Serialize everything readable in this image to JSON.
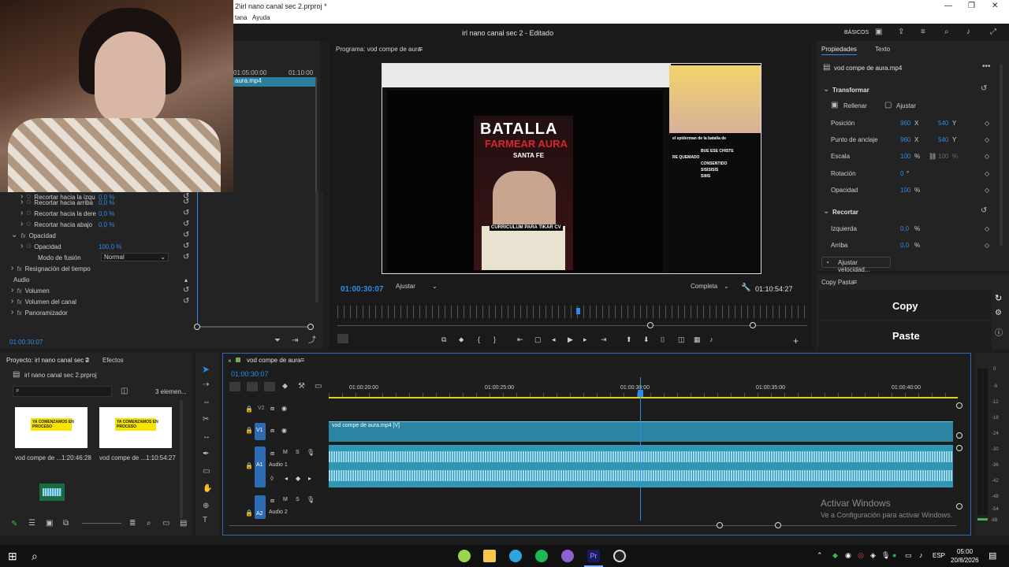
{
  "window": {
    "title": "2\\irl nano canal sec 2.prproj *",
    "controls": [
      "—",
      "❐",
      "✕"
    ]
  },
  "menu": [
    "tana",
    "Ayuda"
  ],
  "appbar": {
    "center_title": "irl nano canal sec 2 - Editado",
    "workspace": "BÁSICOS"
  },
  "source_panel": {
    "tc_left": "01:05:00:00",
    "tc_right": "01:10:00",
    "clip": "aura.mp4"
  },
  "effects": {
    "rows": [
      {
        "label": "Recortar hacia la izqu",
        "value": "0,0 %"
      },
      {
        "label": "Recortar hacia arriba",
        "value": "0,0 %"
      },
      {
        "label": "Recortar hacia la dere",
        "value": "0,0 %"
      },
      {
        "label": "Recortar hacia abajo",
        "value": "0,0 %"
      }
    ],
    "opacidad_group": "Opacidad",
    "opacidad_label": "Opacidad",
    "opacidad_value": "100,0 %",
    "blend_label": "Modo de fusión",
    "blend_value": "Normal",
    "time_remap": "Resignación del tiempo",
    "audio_header": "Audio",
    "audio_rows": [
      "Volumen",
      "Volumen del canal",
      "Panoramizador"
    ],
    "timecode": "01:00:30:07"
  },
  "program": {
    "title": "Programa: vod compe de aura",
    "timecode": "01:00:30:07",
    "fit": "Ajustar",
    "quality": "Completa",
    "duration": "01:10:54:27",
    "playhead_fraction": 0.5,
    "screen_text": {
      "poster_title": "BATALLA",
      "poster_sub": "FARMEAR AURA",
      "poster_city": "SANTA FE",
      "caption": "CURRICULUM PARA TIKAR CV",
      "chat": [
        "el spiderman de la batalla de",
        "BUE ESE CHISTE",
        "RE QUEMADO",
        "CONSENTIDO",
        "SISISISIS",
        "SIIIIS"
      ]
    }
  },
  "properties": {
    "tab_active": "Propiedades",
    "tab_other": "Texto",
    "clip_name": "vod compe de aura.mp4",
    "transform_header": "Transformar",
    "fill_label": "Rellenar",
    "fit_label": "Ajustar",
    "rows": [
      {
        "label": "Posición",
        "v1": "960",
        "u1": "X",
        "v2": "540",
        "u2": "Y"
      },
      {
        "label": "Punto de anclaje",
        "v1": "960",
        "u1": "X",
        "v2": "540",
        "u2": "Y"
      },
      {
        "label": "Escala",
        "v1": "100",
        "u1": "%",
        "v2": "100",
        "u2": "%"
      },
      {
        "label": "Rotación",
        "v1": "0",
        "u1": "°",
        "v2": "",
        "u2": ""
      },
      {
        "label": "Opacidad",
        "v1": "100",
        "u1": "%",
        "v2": "",
        "u2": ""
      }
    ],
    "crop_header": "Recortar",
    "crop_rows": [
      {
        "label": "Izquierda",
        "v": "0,0",
        "u": "%"
      },
      {
        "label": "Arriba",
        "v": "0,0",
        "u": "%"
      }
    ],
    "speed_button": "Ajustar velocidad..."
  },
  "copypaste": {
    "title": "Copy Pasta",
    "copy": "Copy",
    "paste": "Paste"
  },
  "project": {
    "tab_project": "Proyecto: irl nano canal sec 2",
    "tab_effects": "Efectos",
    "file": "irl nano canal sec 2.prproj",
    "count": "3 elemen...",
    "items": [
      {
        "name": "vod compe de ...",
        "dur": "1:20:46:28",
        "thumb_text": "YA COMENZAMOS EN PROCESO"
      },
      {
        "name": "vod compe de ...",
        "dur": "1:10:54:27",
        "thumb_text": "YA COMENZAMOS EN PROCESO"
      }
    ]
  },
  "timeline": {
    "sequence": "vod compe de aura",
    "timecode": "01:00:30:07",
    "ruler": [
      "01:00:20:00",
      "01:00:25:00",
      "01:00:30:00",
      "01:00:35:00",
      "01:00:40:00"
    ],
    "tracks": [
      {
        "id": "V2",
        "name": ""
      },
      {
        "id": "V1",
        "name": ""
      },
      {
        "id": "A1",
        "name": "Audio 1"
      },
      {
        "id": "A2",
        "name": "Audio 2"
      }
    ],
    "video_clip": "vod compe de aura.mp4 [V]",
    "meter_labels": [
      "0",
      "-6",
      "-12",
      "-18",
      "-24",
      "-30",
      "-36",
      "-42",
      "-48",
      "-54",
      "dB"
    ]
  },
  "watermark": {
    "line1": "Activar Windows",
    "line2": "Ve a Configuración para activar Windows."
  },
  "taskbar": {
    "lang": "ESP",
    "time": "05:00",
    "date": "20/8/2026"
  }
}
